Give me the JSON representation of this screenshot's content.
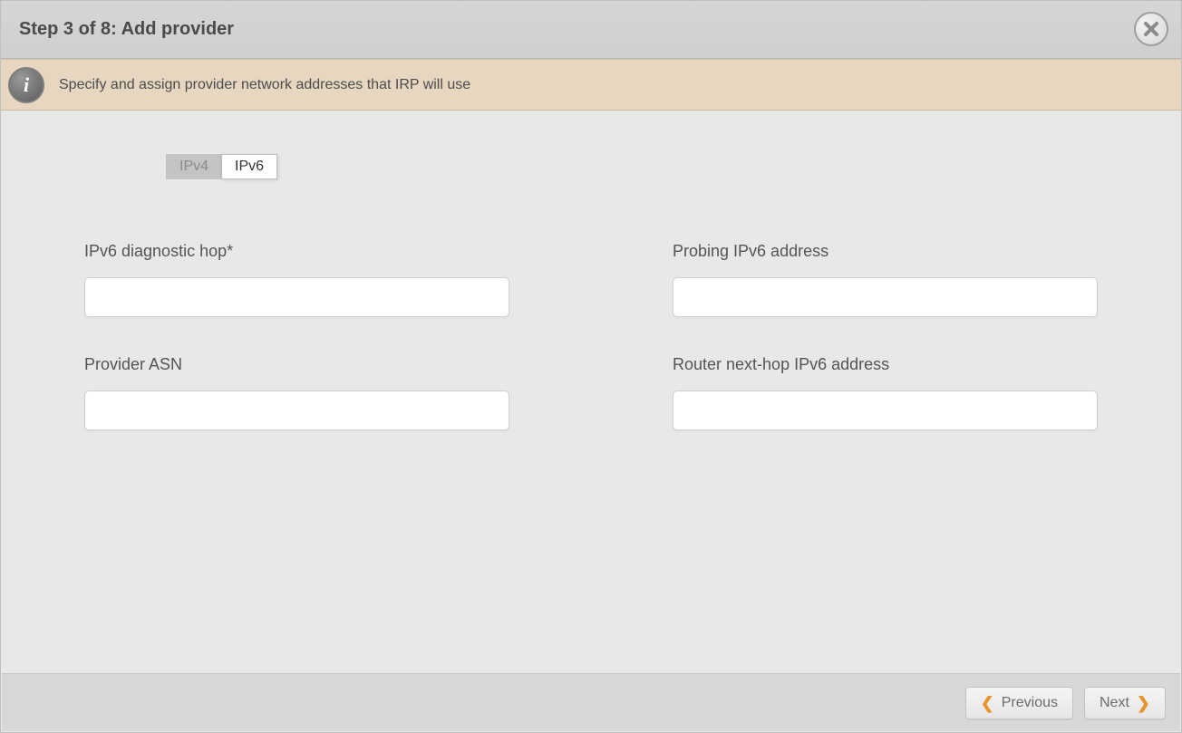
{
  "header": {
    "title": "Step 3 of 8: Add provider"
  },
  "banner": {
    "text": "Specify and assign provider network addresses that IRP will use"
  },
  "tabs": {
    "ipv4": "IPv4",
    "ipv6": "IPv6",
    "active": "IPv6"
  },
  "fields": {
    "diag_hop": {
      "label": "IPv6 diagnostic hop*",
      "value": ""
    },
    "probing": {
      "label": "Probing IPv6 address",
      "value": ""
    },
    "asn": {
      "label": "Provider ASN",
      "value": ""
    },
    "nexthop": {
      "label": "Router next-hop IPv6 address",
      "value": ""
    }
  },
  "footer": {
    "prev": "Previous",
    "next": "Next"
  },
  "glyphs": {
    "chev_left": "❮",
    "chev_right": "❯",
    "info": "i"
  },
  "colors": {
    "accent": "#e8962c",
    "banner_bg": "#e7d7c1"
  }
}
